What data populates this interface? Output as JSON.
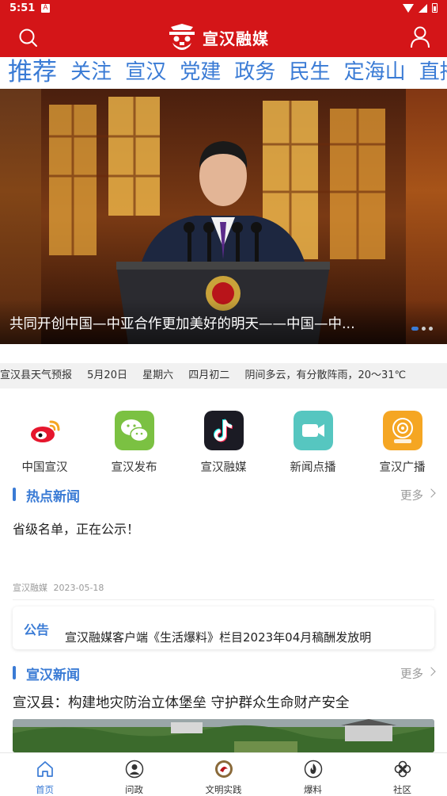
{
  "status": {
    "time": "5:51",
    "badge": "A"
  },
  "header": {
    "app_name": "宣汉融媒",
    "search_icon": "search-icon",
    "user_icon": "user-icon"
  },
  "tabs": [
    "推荐",
    "关注",
    "宣汉",
    "党建",
    "政务",
    "民生",
    "定海山",
    "直播"
  ],
  "active_tab": 0,
  "banner": {
    "caption": "共同开创中国—中亚合作更加美好的明天——中国—中...",
    "slide_count": 3,
    "active_slide": 0
  },
  "weather": {
    "title": "宣汉县天气预报",
    "date": "5月20日",
    "weekday": "星期六",
    "lunar": "四月初二",
    "forecast": "阴间多云，有分散阵雨，20～31℃"
  },
  "quick_links": [
    {
      "label": "中国宣汉",
      "icon": "weibo-icon",
      "color": "#ffffff"
    },
    {
      "label": "宣汉发布",
      "icon": "wechat-icon",
      "color": "#7bc142"
    },
    {
      "label": "宣汉融媒",
      "icon": "tiktok-icon",
      "color": "#1b1b24"
    },
    {
      "label": "新闻点播",
      "icon": "video-camera-icon",
      "color": "#56c6c0"
    },
    {
      "label": "宣汉广播",
      "icon": "radio-icon",
      "color": "#f5a623"
    }
  ],
  "hot_news": {
    "section_title": "热点新闻",
    "more_label": "更多",
    "title": "省级名单，正在公示！",
    "source": "宣汉融媒",
    "date": "2023-05-18"
  },
  "notice": {
    "label": "公告",
    "text": "宣汉融媒客户端《生活爆料》栏目2023年04月稿酬发放明"
  },
  "xuanhan_news": {
    "section_title": "宣汉新闻",
    "more_label": "更多",
    "title": "宣汉县：构建地灾防治立体堡垒 守护群众生命财产安全"
  },
  "bottom_nav": [
    {
      "label": "首页",
      "icon": "home-icon"
    },
    {
      "label": "问政",
      "icon": "person-icon"
    },
    {
      "label": "文明实践",
      "icon": "civilization-emblem-icon"
    },
    {
      "label": "爆料",
      "icon": "flame-icon"
    },
    {
      "label": "社区",
      "icon": "clover-icon"
    }
  ],
  "active_nav": 0,
  "colors": {
    "brand_red": "#d41518",
    "accent_blue": "#3a7bd5"
  }
}
